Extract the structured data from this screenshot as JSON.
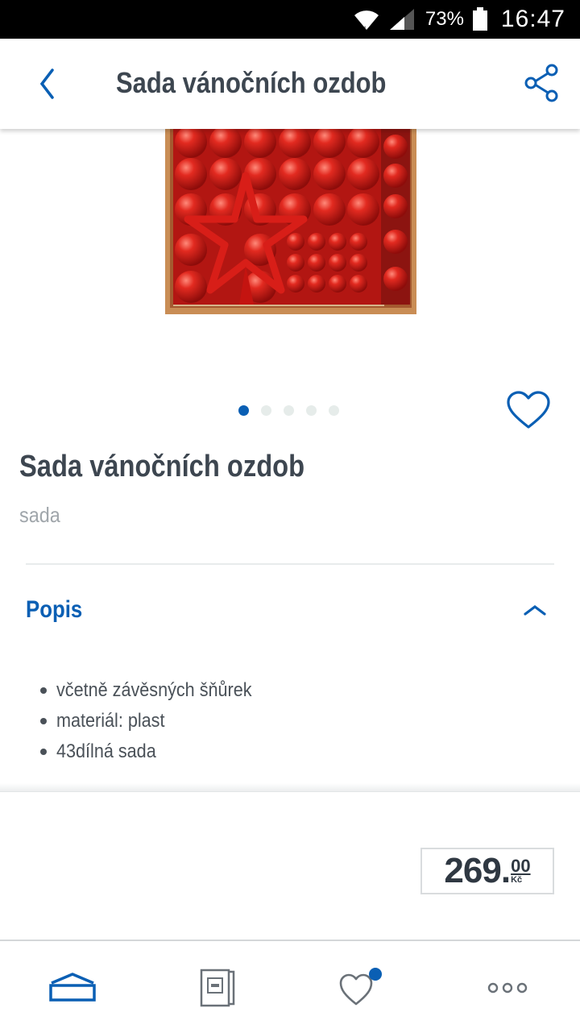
{
  "status_bar": {
    "battery_percent": "73%",
    "time": "16:47",
    "icons": [
      "wifi-icon",
      "signal-icon",
      "battery-icon"
    ]
  },
  "app_bar": {
    "title": "Sada vánočních ozdob",
    "back_icon": "chevron-left-icon",
    "share_icon": "share-icon"
  },
  "carousel": {
    "page_count": 5,
    "active_index": 0,
    "favorite_icon": "heart-outline-icon"
  },
  "product": {
    "title": "Sada vánočních ozdob",
    "subtitle": "sada"
  },
  "description": {
    "section_title": "Popis",
    "expanded": true,
    "items": [
      "včetně závěsných šňůrek",
      "materiál: plast",
      "43dílná sada"
    ]
  },
  "price": {
    "main": "269",
    "dot": ".",
    "cents": "00",
    "currency": "Kč"
  },
  "bottom_nav": {
    "items": [
      "home-icon",
      "leaflet-icon",
      "favorites-icon",
      "more-icon"
    ],
    "favorites_badge": true
  },
  "colors": {
    "accent": "#0a5fb4",
    "text": "#3d4650",
    "muted": "#a0a6ab",
    "ornament_red": "#d41818"
  }
}
